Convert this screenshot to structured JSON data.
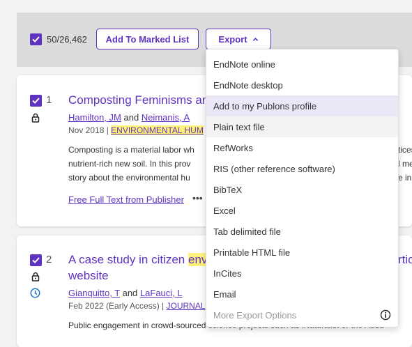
{
  "toolbar": {
    "selected_count": "50/26,462",
    "add_to_marked_list_label": "Add To Marked List",
    "export_label": "Export"
  },
  "export_menu": {
    "items": [
      {
        "label": "EndNote online"
      },
      {
        "label": "EndNote desktop"
      },
      {
        "label": "Add to my Publons profile"
      },
      {
        "label": "Plain text file"
      },
      {
        "label": "RefWorks"
      },
      {
        "label": "RIS (other reference software)"
      },
      {
        "label": "BibTeX"
      },
      {
        "label": "Excel"
      },
      {
        "label": "Tab delimited file"
      },
      {
        "label": "Printable HTML file"
      },
      {
        "label": "InCites"
      },
      {
        "label": "Email"
      },
      {
        "label": "More Export Options"
      }
    ]
  },
  "results": [
    {
      "index": "1",
      "title": "Composting Feminisms an",
      "author1": "Hamilton, JM",
      "and": "and",
      "author2": "Neimanis, A",
      "date": "Nov 2018 | ",
      "journal_hl1": "ENVIRONMENTAL",
      "journal_rest": " HUM",
      "abstract_lines": [
        "Composting is a material labor wh",
        "nutrient-rich new soil. In this prov",
        "story about the environmental hu"
      ],
      "right_frags": [
        "tices",
        "l me",
        "e in"
      ],
      "full_text_link": "Free Full Text from Publisher",
      "more": "•••"
    },
    {
      "index": "2",
      "title_pre": "A case study in citizen ",
      "title_hl": "envi",
      "title_right": "rtic",
      "title_line2": "website",
      "author1": "Gianquitto, T",
      "and": "and",
      "author2": "LaFauci, L",
      "date": "Feb 2022 (Early Access) | ",
      "journal": "JOURNAL",
      "abstract_line1": "Public engagement in crowd-sourced science projects such as iNaturalist or the Audu"
    }
  ],
  "colors": {
    "accent": "#5e33bf",
    "highlight": "#fff27a",
    "menu_hover": "#ece7f7"
  }
}
